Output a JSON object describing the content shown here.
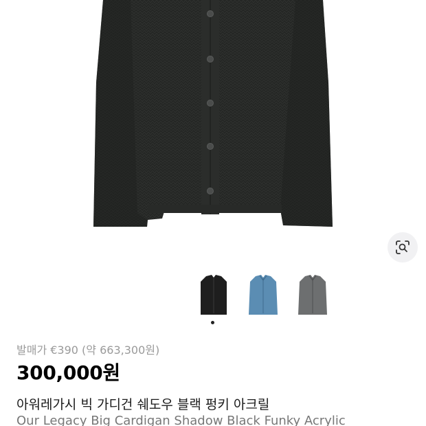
{
  "product": {
    "image_subject": "black knit cardigan",
    "thumbnails": [
      {
        "name": "black",
        "color": "#1e1e1e"
      },
      {
        "name": "blue",
        "color": "#5b8db3"
      },
      {
        "name": "grey",
        "color": "#6d6f70"
      }
    ],
    "active_thumbnail_index": 0,
    "retail_price": "발매가 €390 (약 663,300원)",
    "price": "300,000원",
    "title_kr": "아워레가시 빅 가디건 쉐도우 블랙 펑키 아크릴",
    "title_en": "Our Legacy Big Cardigan Shadow Black Funky Acrylic"
  },
  "icons": {
    "lens": "image-search-icon"
  },
  "colors": {
    "cardigan": "#242624",
    "buttons": "#4a4c4b",
    "lens_bg": "#f1f1f3",
    "muted_text": "#9a9a9a"
  }
}
